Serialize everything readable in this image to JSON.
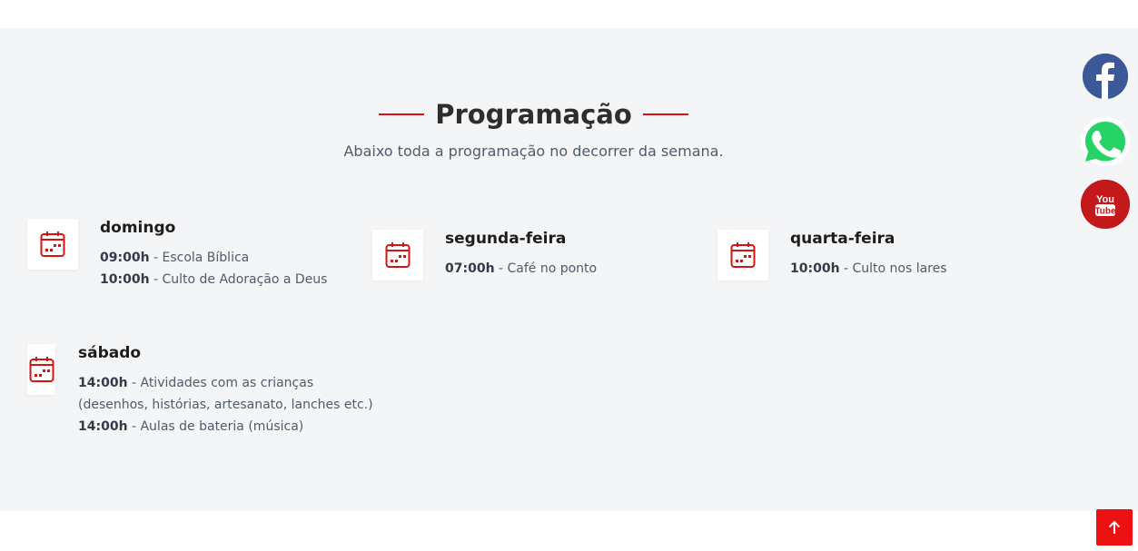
{
  "section": {
    "title": "Programação",
    "subtitle": "Abaixo toda a programação no decorrer da semana."
  },
  "schedule": [
    {
      "day": "domingo",
      "entries": [
        {
          "time": "09:00h",
          "activity": " - Escola Bíblica"
        },
        {
          "time": "10:00h",
          "activity": " - Culto de Adoração a Deus"
        }
      ]
    },
    {
      "day": "segunda-feira",
      "entries": [
        {
          "time": "07:00h",
          "activity": " - Café no ponto"
        }
      ]
    },
    {
      "day": "quarta-feira",
      "entries": [
        {
          "time": "10:00h",
          "activity": " - Culto nos lares"
        }
      ]
    },
    {
      "day": "sábado",
      "entries": [
        {
          "time": "14:00h",
          "activity": " - Atividades com as crianças"
        },
        {
          "time": "",
          "activity": "(desenhos, histórias, artesanato, lanches etc.)"
        },
        {
          "time": "14:00h",
          "activity": " - Aulas de bateria (música)"
        }
      ]
    }
  ],
  "social": {
    "facebook_icon": "facebook-icon",
    "whatsapp_icon": "whatsapp-icon",
    "youtube_label_top": "You",
    "youtube_label_bottom": "Tube"
  },
  "colors": {
    "accent": "#d61313",
    "section_bg": "#f4f5f7",
    "facebook": "#3b5998",
    "whatsapp": "#25d366",
    "youtube": "#c4191a",
    "scroll_top": "#ee1111"
  }
}
